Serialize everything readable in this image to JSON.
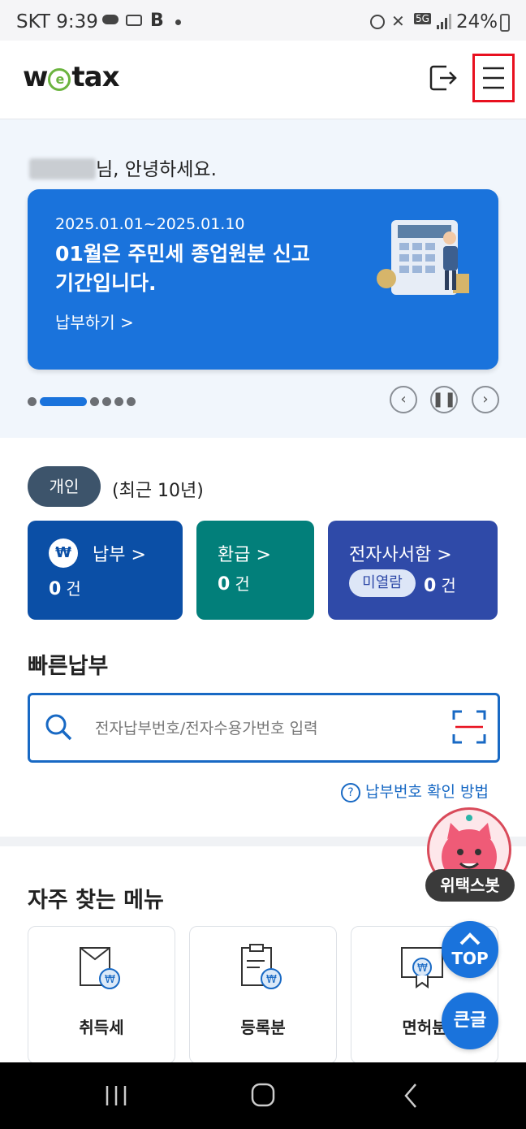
{
  "status_bar": {
    "carrier_time": "SKT 9:39",
    "battery": "24%",
    "network": "5G"
  },
  "header": {
    "logo_text_pre": "w",
    "logo_text_e": "e",
    "logo_text_post": "tax"
  },
  "hero": {
    "greeting": "님, 안녕하세요.",
    "banner": {
      "date_range": "2025.01.01~2025.01.10",
      "title": "01월은 주민세 종업원분 신고 기간입니다.",
      "action": "납부하기 >"
    }
  },
  "summary": {
    "type_pill": "개인",
    "period": "(최근 10년)",
    "cards": [
      {
        "label": "납부 >",
        "count": "0",
        "unit": "건",
        "icon": "won-icon"
      },
      {
        "label": "환급 >",
        "count": "0",
        "unit": "건"
      },
      {
        "label": "전자사서함 >",
        "badge": "미열람",
        "count": "0",
        "unit": "건"
      }
    ]
  },
  "quick_pay": {
    "title": "빠른납부",
    "placeholder": "전자납부번호/전자수용가번호 입력",
    "help_link": "납부번호 확인 방법"
  },
  "frequent_menu": {
    "title": "자주 찾는 메뉴",
    "items": [
      {
        "label": "취득세"
      },
      {
        "label": "등록분"
      },
      {
        "label": "면허분"
      }
    ]
  },
  "floating": {
    "bot_label": "위택스봇",
    "top_label": "TOP",
    "big_text_label": "큰글"
  },
  "colors": {
    "brand_blue": "#1a73dc",
    "navy": "#0b4fa6",
    "teal": "#027f7a",
    "indigo": "#2f4aa8",
    "logo_green": "#6bb43f"
  }
}
